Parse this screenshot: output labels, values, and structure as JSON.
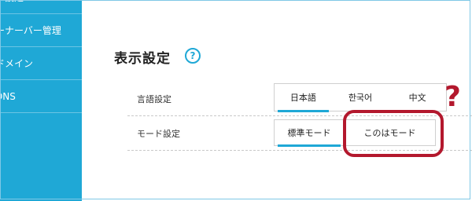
{
  "sidebar": {
    "items": [
      {
        "label": "ア設定"
      },
      {
        "label": "ーナーバー管理"
      },
      {
        "label": "ドメイン"
      },
      {
        "label": "DNS"
      }
    ]
  },
  "main": {
    "title": "表示設定",
    "help_icon_glyph": "?",
    "rows": [
      {
        "label": "言語設定",
        "options": [
          "日本語",
          "한국어",
          "中文"
        ],
        "selected": "日本語"
      },
      {
        "label": "モード設定",
        "options": [
          "標準モード",
          "このはモード"
        ],
        "selected": "標準モード"
      }
    ]
  },
  "annotation": {
    "question_mark": "?",
    "accent_color": "#b3182d"
  },
  "colors": {
    "sidebar": "#1fa8d6",
    "active_underline": "#1fa8d6"
  }
}
